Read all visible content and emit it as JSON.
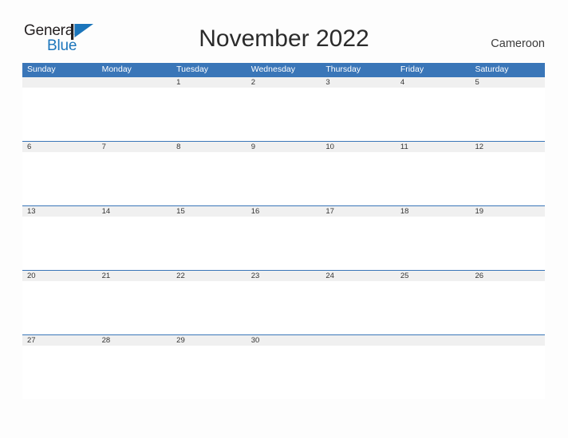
{
  "brand": {
    "name_part1": "General",
    "name_part2": "Blue",
    "flag_icon": "flag-triangle-icon",
    "color_dark": "#231f20",
    "color_blue": "#1b75bb"
  },
  "header": {
    "title": "November 2022",
    "country": "Cameroon"
  },
  "calendar": {
    "accent_color": "#3a76b8",
    "band_color": "#f0f0f0",
    "weekdays": [
      "Sunday",
      "Monday",
      "Tuesday",
      "Wednesday",
      "Thursday",
      "Friday",
      "Saturday"
    ],
    "weeks": [
      [
        "",
        "",
        "1",
        "2",
        "3",
        "4",
        "5"
      ],
      [
        "6",
        "7",
        "8",
        "9",
        "10",
        "11",
        "12"
      ],
      [
        "13",
        "14",
        "15",
        "16",
        "17",
        "18",
        "19"
      ],
      [
        "20",
        "21",
        "22",
        "23",
        "24",
        "25",
        "26"
      ],
      [
        "27",
        "28",
        "29",
        "30",
        "",
        "",
        ""
      ]
    ]
  }
}
